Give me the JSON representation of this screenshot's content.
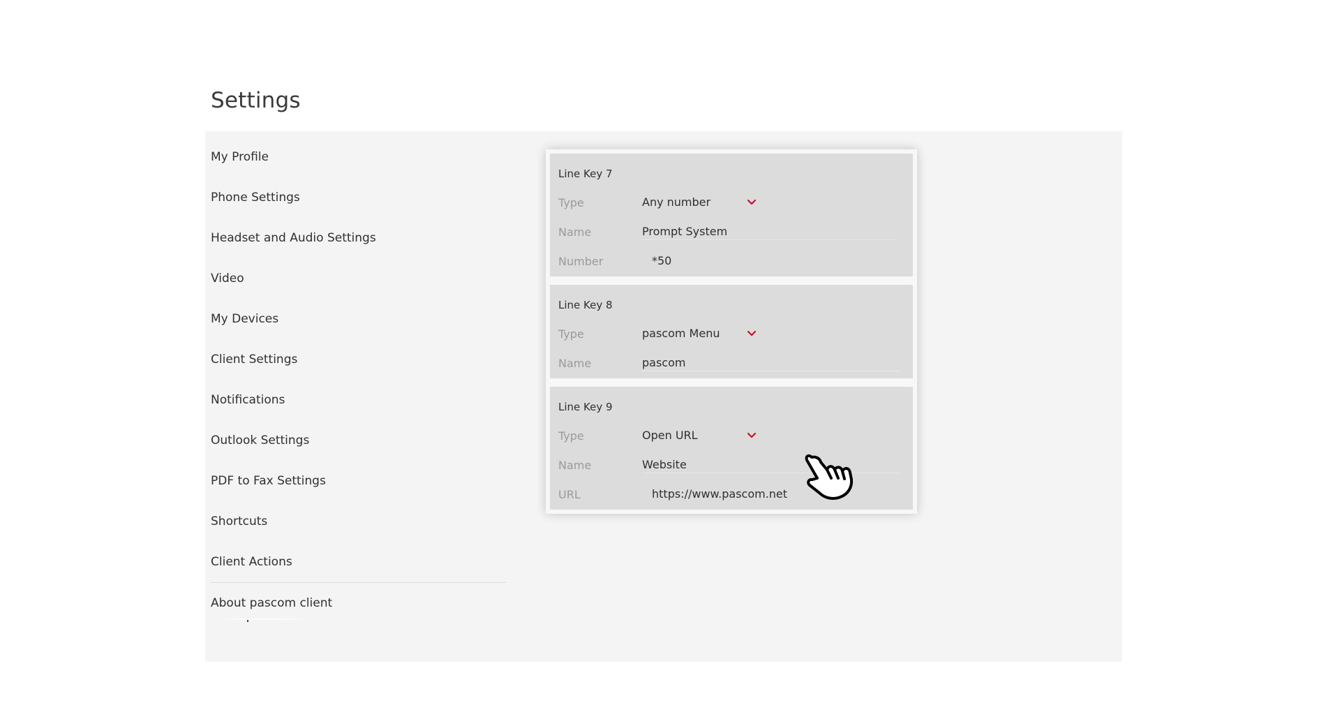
{
  "page": {
    "title": "Settings"
  },
  "sidebar": {
    "items": [
      {
        "label": "My Profile"
      },
      {
        "label": "Phone Settings"
      },
      {
        "label": "Headset and Audio Settings"
      },
      {
        "label": "Video"
      },
      {
        "label": "My Devices"
      },
      {
        "label": "Client Settings"
      },
      {
        "label": "Notifications"
      },
      {
        "label": "Outlook Settings"
      },
      {
        "label": "PDF to Fax Settings"
      },
      {
        "label": "Shortcuts"
      },
      {
        "label": "Client Actions"
      },
      {
        "label": "About pascom client"
      }
    ]
  },
  "line_keys": [
    {
      "title": "Line Key 7",
      "fields": [
        {
          "label": "Type",
          "value": "Any number",
          "icon": "chevron-down-icon"
        },
        {
          "label": "Name",
          "value": "Prompt System"
        },
        {
          "label": "Number",
          "value": "*50"
        }
      ]
    },
    {
      "title": "Line Key 8",
      "fields": [
        {
          "label": "Type",
          "value": "pascom Menu",
          "icon": "chevron-down-icon"
        },
        {
          "label": "Name",
          "value": "pascom"
        }
      ]
    },
    {
      "title": "Line Key 9",
      "fields": [
        {
          "label": "Type",
          "value": "Open URL",
          "icon": "chevron-down-icon"
        },
        {
          "label": "Name",
          "value": "Website"
        },
        {
          "label": "URL",
          "value": "https://www.pascom.net"
        }
      ]
    }
  ],
  "colors": {
    "accent": "#c8102e",
    "background": "#f4f4f4",
    "card": "#dcdcdc"
  }
}
